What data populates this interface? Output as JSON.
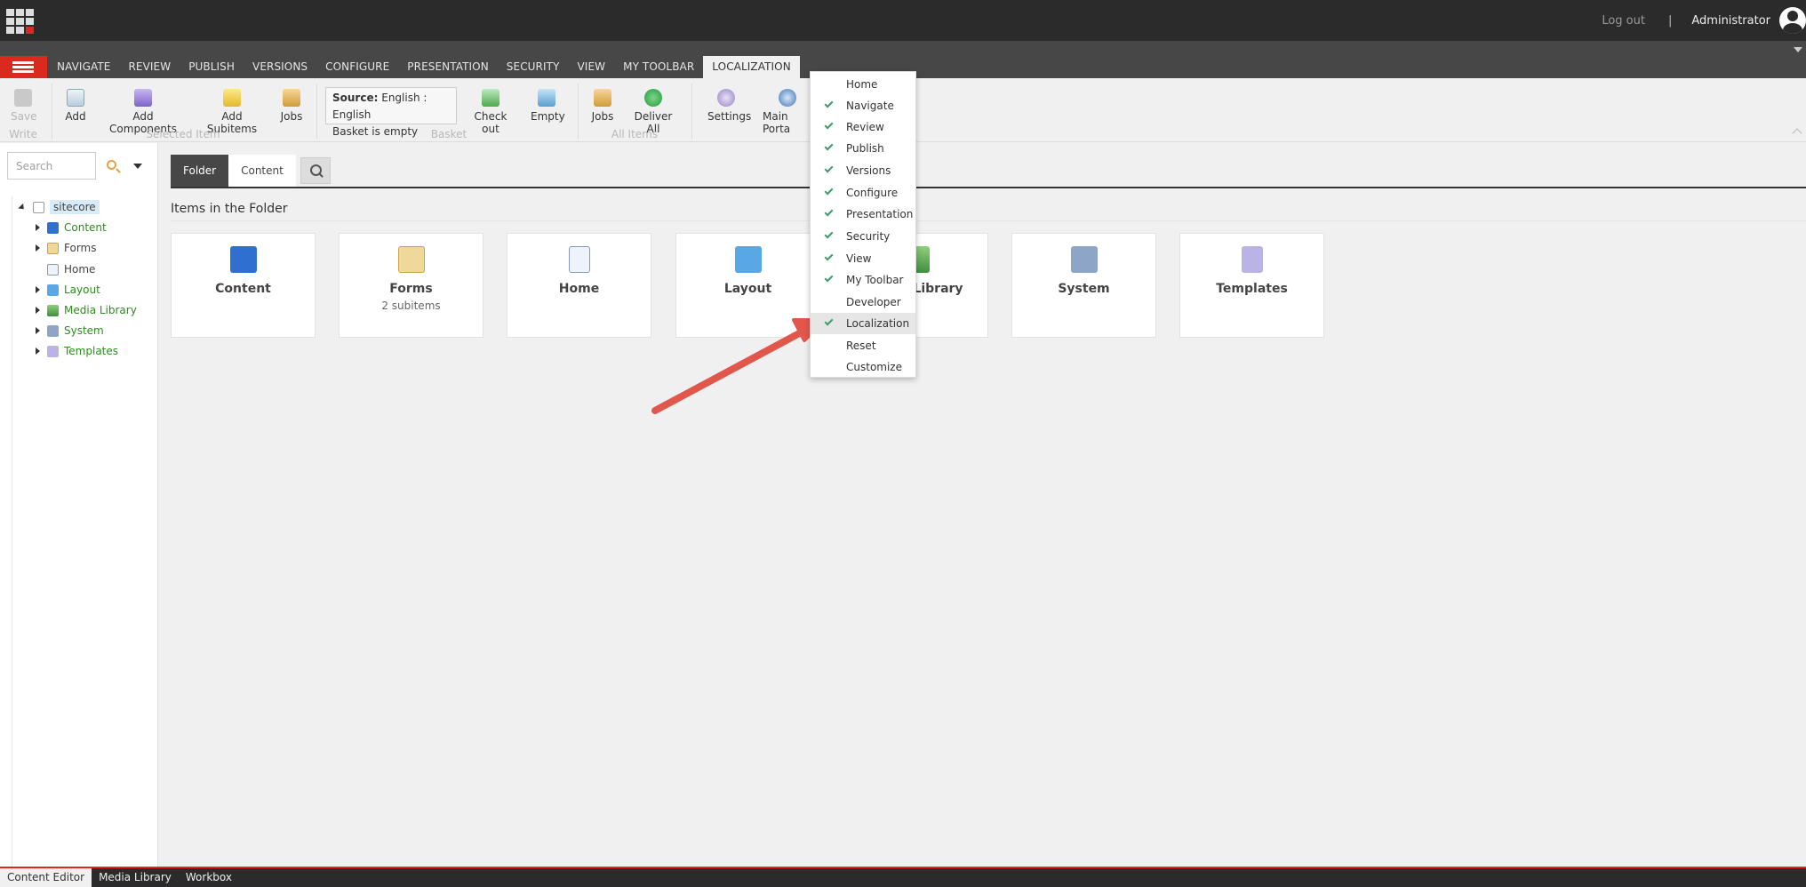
{
  "topbar": {
    "logout": "Log out",
    "separator": "|",
    "user": "Administrator"
  },
  "tabs": [
    "NAVIGATE",
    "REVIEW",
    "PUBLISH",
    "VERSIONS",
    "CONFIGURE",
    "PRESENTATION",
    "SECURITY",
    "VIEW",
    "MY TOOLBAR",
    "LOCALIZATION"
  ],
  "active_tab": "LOCALIZATION",
  "ribbon": {
    "save": "Save",
    "add": "Add",
    "add_components": "Add Components",
    "add_subitems": "Add Subitems",
    "jobs": "Jobs",
    "source_label": "Source:",
    "source_value": "English : English",
    "basket_status": "Basket is empty",
    "check_out": "Check out",
    "empty": "Empty",
    "jobs2": "Jobs",
    "deliver_all": "Deliver All",
    "settings": "Settings",
    "main_portal": "Main Porta",
    "groups": {
      "write": "Write",
      "selected_item": "Selected Item",
      "basket": "Basket",
      "all_items": "All Items"
    }
  },
  "search": {
    "placeholder": "Search"
  },
  "tree": {
    "root": "sitecore",
    "items": [
      "Content",
      "Forms",
      "Home",
      "Layout",
      "Media Library",
      "System",
      "Templates"
    ]
  },
  "main_tabs": [
    "Folder",
    "Content"
  ],
  "section_title": "Items in the Folder",
  "cards": [
    {
      "name": "Content",
      "sub": ""
    },
    {
      "name": "Forms",
      "sub": "2 subitems"
    },
    {
      "name": "Home",
      "sub": ""
    },
    {
      "name": "Layout",
      "sub": ""
    },
    {
      "name": "Library",
      "sub": ""
    },
    {
      "name": "System",
      "sub": ""
    },
    {
      "name": "Templates",
      "sub": ""
    }
  ],
  "menu": [
    {
      "label": "Home",
      "checked": false
    },
    {
      "label": "Navigate",
      "checked": true
    },
    {
      "label": "Review",
      "checked": true
    },
    {
      "label": "Publish",
      "checked": true
    },
    {
      "label": "Versions",
      "checked": true
    },
    {
      "label": "Configure",
      "checked": true
    },
    {
      "label": "Presentation",
      "checked": true
    },
    {
      "label": "Security",
      "checked": true
    },
    {
      "label": "View",
      "checked": true
    },
    {
      "label": "My Toolbar",
      "checked": true
    },
    {
      "label": "Developer",
      "checked": false
    },
    {
      "label": "Localization",
      "checked": true
    },
    {
      "label": "Reset",
      "checked": false
    },
    {
      "label": "Customize",
      "checked": false
    }
  ],
  "bottom_tabs": [
    "Content Editor",
    "Media Library",
    "Workbox"
  ],
  "colors": {
    "accent_red": "#dc291e",
    "dark": "#2b2b2b",
    "tree_green": "#2e8b1f",
    "check_green": "#3f9b6b"
  }
}
